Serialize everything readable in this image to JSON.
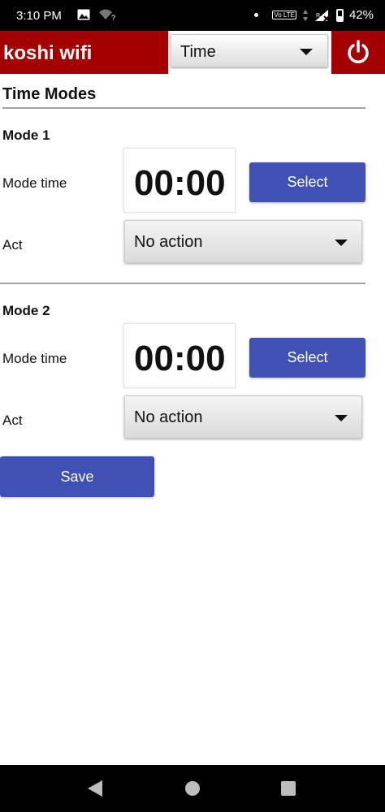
{
  "status_bar": {
    "time": "3:10 PM",
    "battery": "42%",
    "volte": "Vo LTE",
    "icons": [
      "image-icon",
      "wifi-question-icon",
      "notification-dot-icon",
      "volte-icon",
      "data-arrows-icon",
      "signal-icon",
      "battery-icon"
    ]
  },
  "header": {
    "title": "koshi wifi",
    "mode_select": {
      "selected": "Time"
    },
    "power_icon": "power-icon",
    "accent_color": "#a50000"
  },
  "page": {
    "section_title": "Time Modes",
    "modes": [
      {
        "heading": "Mode 1",
        "time_label": "Mode time",
        "time_value": "00:00",
        "select_label": "Select",
        "act_label": "Act",
        "act_value": "No action"
      },
      {
        "heading": "Mode 2",
        "time_label": "Mode time",
        "time_value": "00:00",
        "select_label": "Select",
        "act_label": "Act",
        "act_value": "No action"
      }
    ],
    "save_label": "Save",
    "button_color": "#3f51b5"
  },
  "nav_bar": {
    "icons": [
      "back-icon",
      "home-icon",
      "recents-icon"
    ]
  }
}
